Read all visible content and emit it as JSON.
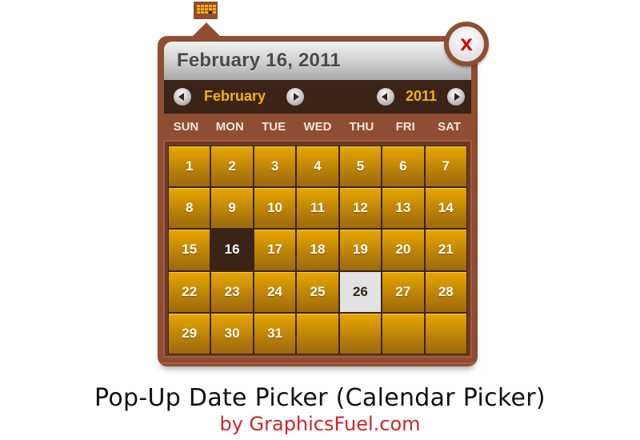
{
  "trigger": {
    "icon": "calendar-icon"
  },
  "picker": {
    "selected_date_display": "February 16, 2011",
    "close_label": "x",
    "month_nav": {
      "prev_icon": "arrow-left-icon",
      "label": "February",
      "next_icon": "arrow-right-icon"
    },
    "year_nav": {
      "prev_icon": "arrow-left-icon",
      "label": "2011",
      "next_icon": "arrow-right-icon"
    },
    "weekdays": [
      "SUN",
      "MON",
      "TUE",
      "WED",
      "THU",
      "FRI",
      "SAT"
    ],
    "days": [
      "1",
      "2",
      "3",
      "4",
      "5",
      "6",
      "7",
      "8",
      "9",
      "10",
      "11",
      "12",
      "13",
      "14",
      "15",
      "16",
      "17",
      "18",
      "19",
      "20",
      "21",
      "22",
      "23",
      "24",
      "25",
      "26",
      "27",
      "28",
      "29",
      "30",
      "31",
      "",
      "",
      "",
      ""
    ],
    "selected_day": "16",
    "highlighted_day": "26",
    "colors": {
      "frame": "#8f4d32",
      "nav_bg": "#3b2318",
      "accent": "#f5b400",
      "cell": "#d99b00",
      "selected": "#3b2318",
      "hover": "#e2e2e2",
      "close_x": "#d40000"
    }
  },
  "caption": {
    "title": "Pop-Up Date Picker (Calendar Picker)",
    "subtitle": "by GraphicsFuel.com"
  }
}
